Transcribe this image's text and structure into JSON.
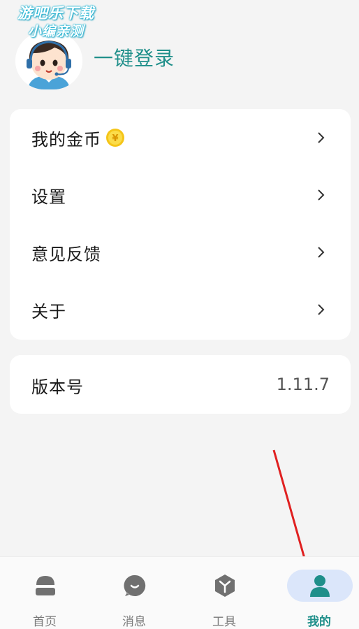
{
  "watermark": {
    "line1": "游吧乐下载",
    "line2": "小编亲测"
  },
  "profile": {
    "login_label": "一键登录"
  },
  "menu": {
    "items": [
      {
        "label": "我的金币",
        "icon": "coin-icon"
      },
      {
        "label": "设置"
      },
      {
        "label": "意见反馈"
      },
      {
        "label": "关于"
      }
    ]
  },
  "version": {
    "label": "版本号",
    "value": "1.11.7"
  },
  "tabbar": {
    "tabs": [
      {
        "label": "首页",
        "icon": "home-icon"
      },
      {
        "label": "消息",
        "icon": "message-icon"
      },
      {
        "label": "工具",
        "icon": "tools-icon"
      },
      {
        "label": "我的",
        "icon": "user-icon",
        "active": true
      }
    ]
  },
  "colors": {
    "accent": "#1f8f8a",
    "active_pill": "#dbe6fa",
    "annotation_arrow": "#e02020"
  }
}
